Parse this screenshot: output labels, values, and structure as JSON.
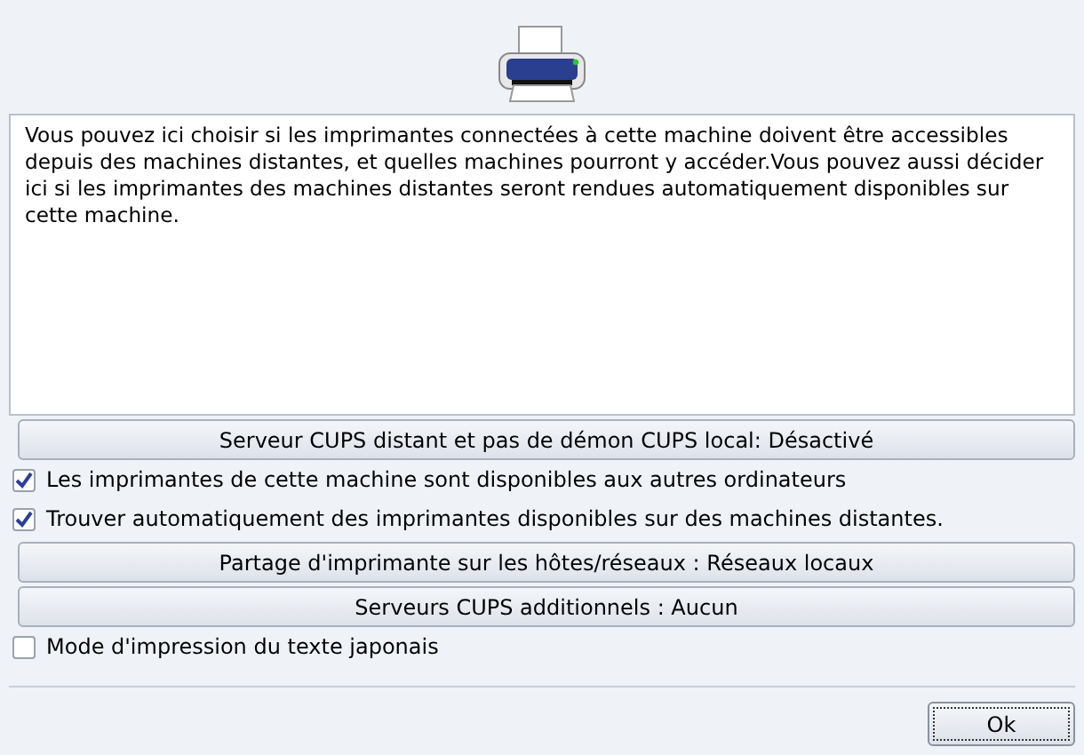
{
  "description": "Vous pouvez ici choisir si les imprimantes connectées à cette machine doivent être accessibles depuis des machines distantes, et quelles machines pourront y accéder.Vous pouvez aussi décider ici si les imprimantes des machines distantes seront rendues automatiquement disponibles sur cette machine.",
  "options": [
    {
      "kind": "button",
      "label": "Serveur CUPS distant et pas de démon CUPS local: Désactivé"
    },
    {
      "kind": "checkbox",
      "label": "Les imprimantes de cette machine sont disponibles aux autres ordinateurs",
      "checked": true
    },
    {
      "kind": "checkbox",
      "label": "Trouver automatiquement des imprimantes disponibles sur des machines distantes.",
      "checked": true
    },
    {
      "kind": "button",
      "label": "Partage d'imprimante sur les hôtes/réseaux : Réseaux locaux"
    },
    {
      "kind": "button",
      "label": "Serveurs CUPS additionnels : Aucun"
    },
    {
      "kind": "checkbox",
      "label": "Mode d'impression du texte japonais",
      "checked": false
    }
  ],
  "buttons": [
    "Ok"
  ]
}
